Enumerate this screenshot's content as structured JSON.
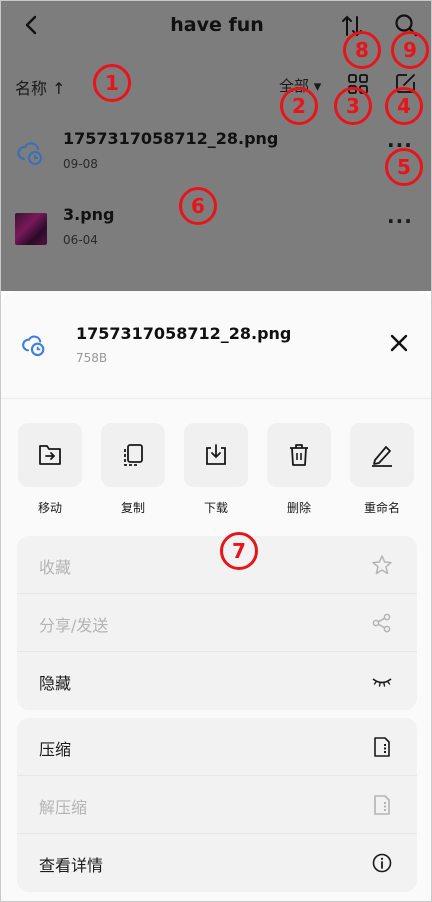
{
  "header": {
    "title": "have fun"
  },
  "toolbar": {
    "sort_label": "名称 ↑",
    "filter_label": "全部 ▾"
  },
  "files": [
    {
      "name": "1757317058712_28.png",
      "date": "09-08"
    },
    {
      "name": "3.png",
      "date": "06-04"
    }
  ],
  "badges": [
    "1",
    "2",
    "3",
    "4",
    "5",
    "6",
    "7",
    "8",
    "9"
  ],
  "sheet": {
    "file_name": "1757317058712_28.png",
    "file_size": "758B",
    "actions": [
      {
        "label": "移动",
        "icon": "move-icon"
      },
      {
        "label": "复制",
        "icon": "copy-icon"
      },
      {
        "label": "下载",
        "icon": "download-icon"
      },
      {
        "label": "删除",
        "icon": "trash-icon"
      },
      {
        "label": "重命名",
        "icon": "rename-icon"
      }
    ],
    "menu_group_1": [
      {
        "label": "收藏",
        "icon": "star-icon",
        "disabled": true
      },
      {
        "label": "分享/发送",
        "icon": "share-icon",
        "disabled": true
      },
      {
        "label": "隐藏",
        "icon": "hide-eye-icon",
        "disabled": false
      }
    ],
    "menu_group_2": [
      {
        "label": "压缩",
        "icon": "compress-icon",
        "disabled": false
      },
      {
        "label": "解压缩",
        "icon": "decompress-icon",
        "disabled": true
      },
      {
        "label": "查看详情",
        "icon": "info-icon",
        "disabled": false
      }
    ]
  },
  "colors": {
    "accent": "#3d7fe0",
    "badge": "#e8141a",
    "overlay": "#7d7d7d"
  }
}
